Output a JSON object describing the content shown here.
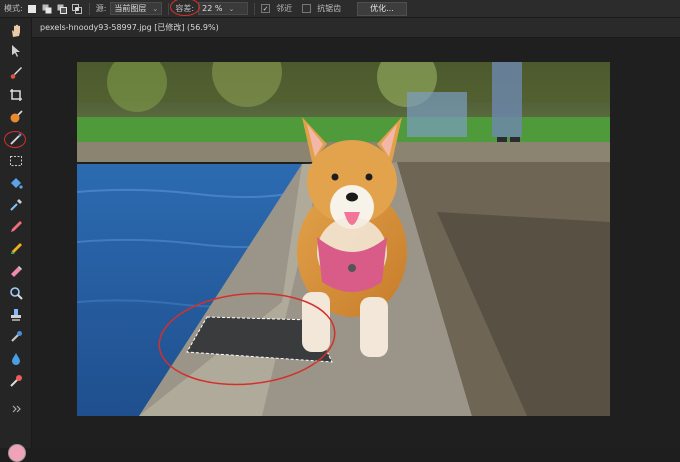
{
  "toolbar_options": {
    "mode_label": "模式:",
    "source_label": "源:",
    "source_value": "当前图层",
    "tolerance_label": "容差:",
    "tolerance_value": "22 %",
    "contiguous_label": "邻近",
    "antialias_label": "抗锯齿",
    "optimize_button": "优化..."
  },
  "document": {
    "tab_title": "pexels-hnoody93-58997.jpg [已修改] (56.9%)"
  },
  "tools": [
    {
      "icon": "hand-icon"
    },
    {
      "icon": "move-icon"
    },
    {
      "icon": "brush-icon"
    },
    {
      "icon": "crop-icon"
    },
    {
      "icon": "healing-icon"
    },
    {
      "icon": "magic-wand-icon",
      "active": true
    },
    {
      "icon": "marquee-icon"
    },
    {
      "icon": "fill-icon"
    },
    {
      "icon": "eyedropper-icon"
    },
    {
      "icon": "pencil-icon"
    },
    {
      "icon": "color-replace-icon"
    },
    {
      "icon": "eraser-icon"
    },
    {
      "icon": "zoom-icon"
    },
    {
      "icon": "clone-stamp-icon"
    },
    {
      "icon": "dropper-icon"
    },
    {
      "icon": "blur-icon"
    },
    {
      "icon": "sponge-icon"
    },
    {
      "icon": "expand-icon"
    }
  ],
  "colors": {
    "foreground": "#f0a3b8",
    "accent_ring": "#d4302b"
  }
}
